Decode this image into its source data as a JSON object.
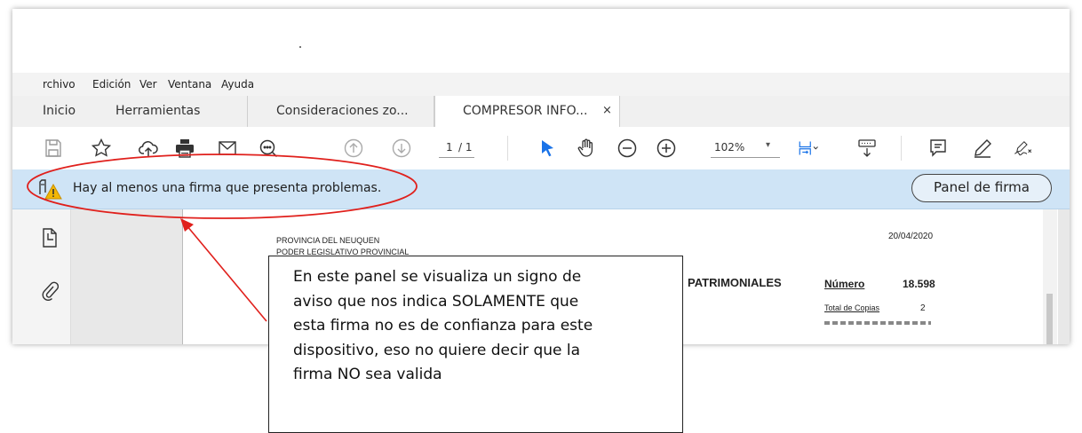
{
  "menu": [
    "rchivo",
    "Edición",
    "Ver",
    "Ventana",
    "Ayuda"
  ],
  "tabs": [
    {
      "label": "Inicio",
      "active": false
    },
    {
      "label": "Herramientas",
      "active": false
    },
    {
      "label": "Consideraciones zo...",
      "active": false
    },
    {
      "label": "COMPRESOR INFO...",
      "active": true,
      "close": "×"
    }
  ],
  "toolbar": {
    "icons": [
      "save-icon",
      "bookmark-star-icon",
      "upload-cloud-icon",
      "print-icon",
      "email-icon",
      "zoom-search-icon",
      "prev-page-icon",
      "next-page-icon",
      "select-pointer-icon",
      "hand-tool-icon",
      "zoom-out-icon",
      "zoom-in-icon",
      "fit-page-icon",
      "scroll-mode-icon",
      "comment-icon",
      "highlight-pen-icon",
      "sign-icon"
    ],
    "page_current": "1",
    "page_total": "/ 1",
    "zoom_value": "102%",
    "zoom_caret": "▾"
  },
  "notification": {
    "message": "Hay al menos una firma que presenta problemas.",
    "button": "Panel de firma",
    "icon": "signature-warning-icon"
  },
  "document": {
    "line1": "PROVINCIA DEL NEUQUEN",
    "line2": "PODER LEGISLATIVO PROVINCIAL",
    "date": "20/04/2020",
    "heading": "PATRIMONIALES",
    "number_label": "Número",
    "number_value": "18.598",
    "copies_label": "Total de Copias",
    "copies_value": "2"
  },
  "callout": {
    "lines": [
      "En este panel se visualiza un signo de",
      "aviso que nos indica SOLAMENTE que",
      "esta firma no es de confianza para este",
      "dispositivo, eso no quiere decir que la",
      "firma NO sea valida"
    ]
  },
  "colors": {
    "notification_bg": "#cfe4f6",
    "annotation_red": "#e0201c",
    "pointer_blue": "#1a73e8",
    "warning_yellow": "#f2b705"
  }
}
